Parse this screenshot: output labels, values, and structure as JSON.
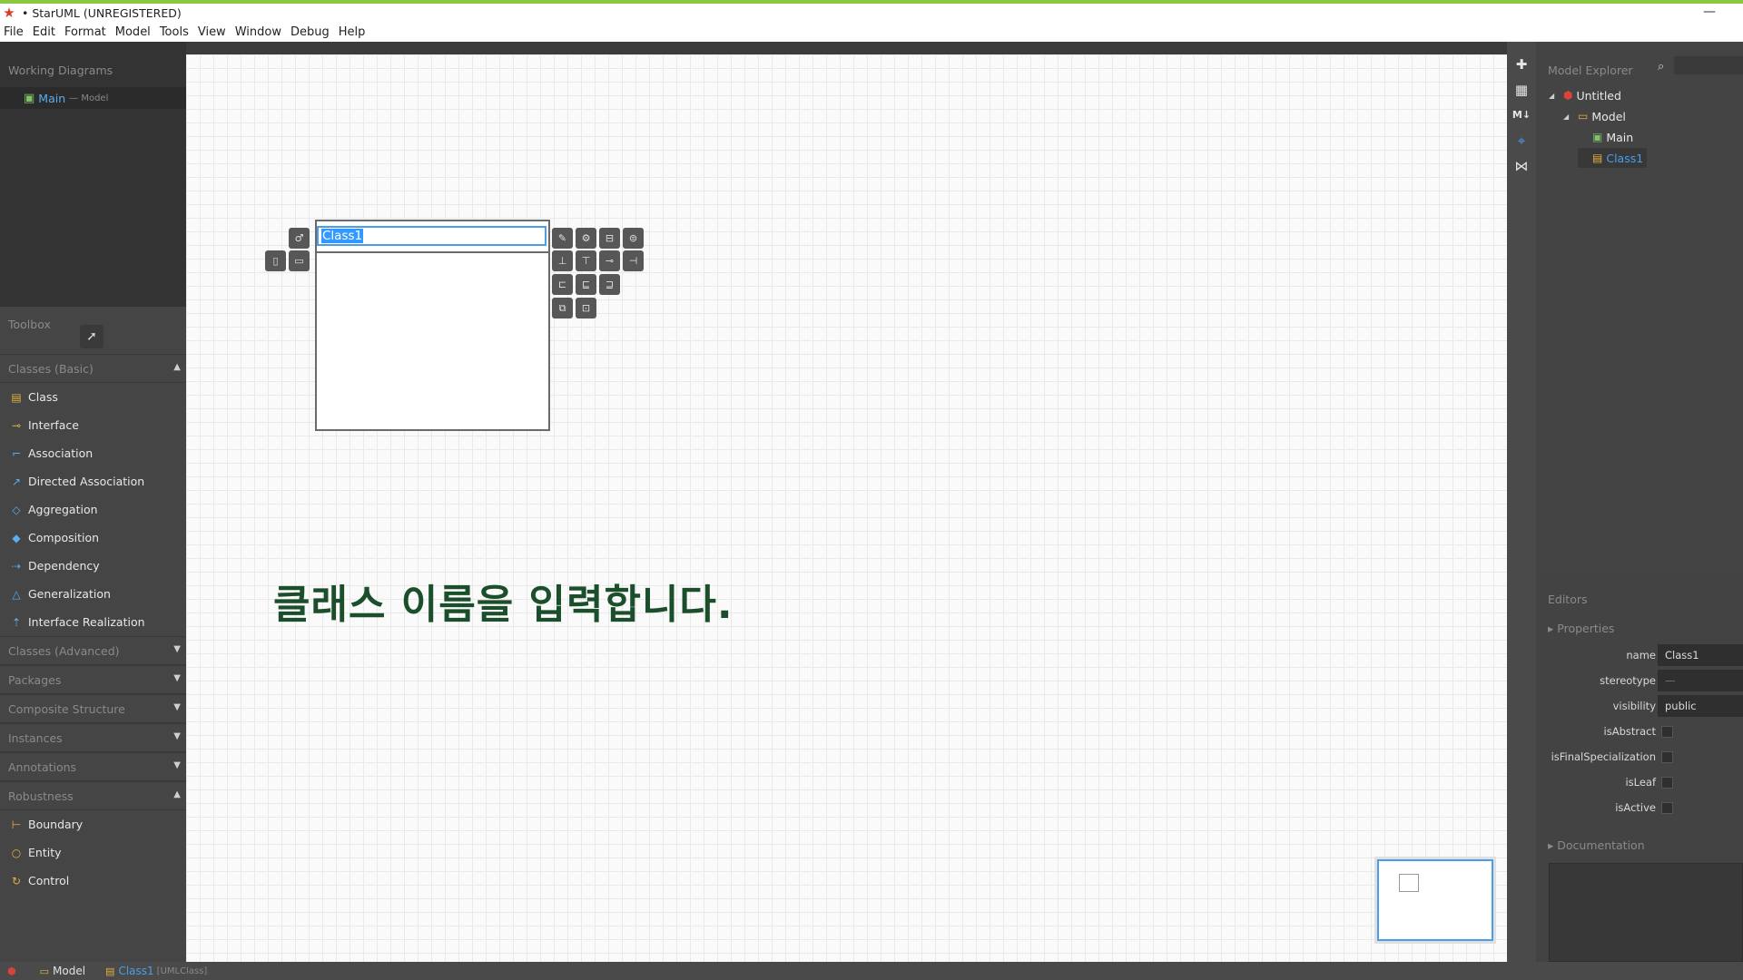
{
  "window": {
    "title": "• StarUML (UNREGISTERED)"
  },
  "menu": [
    "File",
    "Edit",
    "Format",
    "Model",
    "Tools",
    "View",
    "Window",
    "Debug",
    "Help"
  ],
  "working_diagrams": {
    "header": "Working Diagrams",
    "item": {
      "name": "Main",
      "sub": "— Model"
    }
  },
  "toolbox": {
    "header": "Toolbox",
    "sections": [
      {
        "label": "Classes (Basic)",
        "arrow": "▲"
      },
      {
        "label": "Classes (Advanced)",
        "arrow": "▼"
      },
      {
        "label": "Packages",
        "arrow": "▼"
      },
      {
        "label": "Composite Structure",
        "arrow": "▼"
      },
      {
        "label": "Instances",
        "arrow": "▼"
      },
      {
        "label": "Annotations",
        "arrow": "▼"
      },
      {
        "label": "Robustness",
        "arrow": "▲"
      }
    ],
    "basic_items": [
      "Class",
      "Interface",
      "Association",
      "Directed Association",
      "Aggregation",
      "Composition",
      "Dependency",
      "Generalization",
      "Interface Realization"
    ],
    "robustness_items": [
      "Boundary",
      "Entity",
      "Control"
    ]
  },
  "diagram": {
    "class_name": "Class1",
    "caption": "클래스 이름을 입력합니다."
  },
  "explorer": {
    "header": "Model Explorer",
    "tree": [
      {
        "label": "Untitled",
        "toggle": "◢"
      },
      {
        "label": "Model",
        "toggle": "◢"
      },
      {
        "label": "Main",
        "toggle": ""
      },
      {
        "label": "Class1",
        "toggle": ""
      }
    ]
  },
  "editors": {
    "header": "Editors",
    "properties_label": "Properties",
    "fields": {
      "name": {
        "label": "name",
        "value": "Class1"
      },
      "stereotype": {
        "label": "stereotype",
        "value": "—"
      },
      "visibility": {
        "label": "visibility",
        "value": "public"
      },
      "isAbstract": {
        "label": "isAbstract"
      },
      "isFinalSpecialization": {
        "label": "isFinalSpecialization"
      },
      "isLeaf": {
        "label": "isLeaf"
      },
      "isActive": {
        "label": "isActive"
      }
    },
    "documentation_label": "Documentation"
  },
  "statusbar": {
    "model": "Model",
    "selection": "Class1",
    "selection_type": "[UMLClass]"
  },
  "colors": {
    "accent_blue": "#4a9ee8",
    "top_strip": "#8dc63f",
    "caption_green": "#1b4e2b"
  }
}
